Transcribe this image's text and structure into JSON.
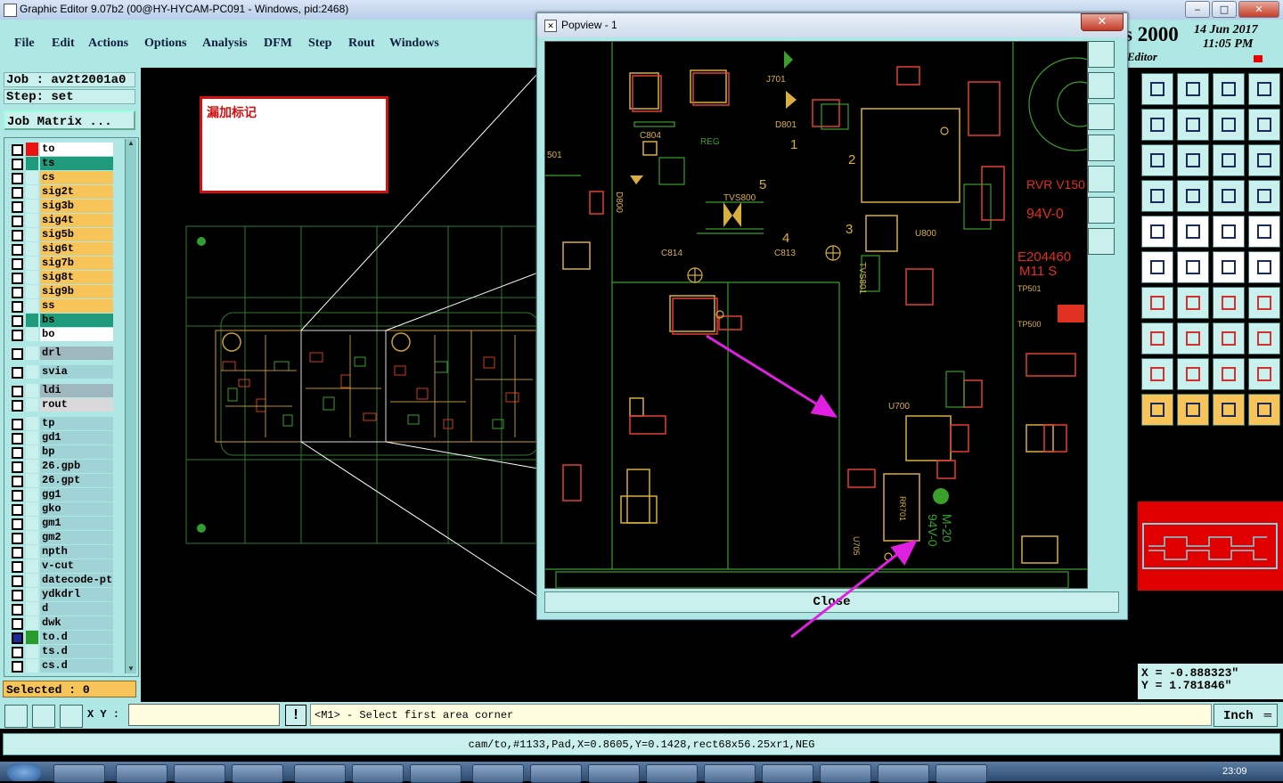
{
  "window": {
    "title": "Graphic Editor 9.07b2 (00@HY-HYCAM-PC091 - Windows, pid:2468)",
    "min": "‒",
    "max": "□",
    "close": "✕"
  },
  "menu": [
    "File",
    "Edit",
    "Actions",
    "Options",
    "Analysis",
    "DFM",
    "Step",
    "Rout",
    "Windows"
  ],
  "header": {
    "product": "s 2000",
    "date": "14 Jun 2017",
    "time": "11:05 PM",
    "editor": "Editor"
  },
  "left": {
    "job": "Job : av2t2001a0",
    "step": "Step: set",
    "job_matrix": "Job Matrix ...",
    "selected": "Selected : 0",
    "layers": [
      {
        "name": "to",
        "color": "#ffffff",
        "swatch": "#ee1111"
      },
      {
        "name": "ts",
        "color": "#1f9a7a",
        "swatch": "#1f9a7a"
      },
      {
        "name": "cs",
        "color": "#f7c45a",
        "swatch": "#c9f0ec"
      },
      {
        "name": "sig2t",
        "color": "#f7c45a",
        "swatch": "#c9f0ec"
      },
      {
        "name": "sig3b",
        "color": "#f7c45a",
        "swatch": "#c9f0ec"
      },
      {
        "name": "sig4t",
        "color": "#f7c45a",
        "swatch": "#c9f0ec"
      },
      {
        "name": "sig5b",
        "color": "#f7c45a",
        "swatch": "#c9f0ec"
      },
      {
        "name": "sig6t",
        "color": "#f7c45a",
        "swatch": "#c9f0ec"
      },
      {
        "name": "sig7b",
        "color": "#f7c45a",
        "swatch": "#c9f0ec"
      },
      {
        "name": "sig8t",
        "color": "#f7c45a",
        "swatch": "#c9f0ec"
      },
      {
        "name": "sig9b",
        "color": "#f7c45a",
        "swatch": "#c9f0ec"
      },
      {
        "name": "ss",
        "color": "#f7c45a",
        "swatch": "#c9f0ec"
      },
      {
        "name": "bs",
        "color": "#1f9a7a",
        "swatch": "#1f9a7a"
      },
      {
        "name": "bo",
        "color": "#ffffff",
        "swatch": "#c9f0ec"
      },
      {
        "name": "drl",
        "color": "#9fb7bf",
        "swatch": "#c9f0ec"
      },
      {
        "name": "svia",
        "color": "#9fd3d5",
        "swatch": "#c9f0ec"
      },
      {
        "name": "ldi",
        "color": "#9fb7bf",
        "swatch": "#c9f0ec"
      },
      {
        "name": "rout",
        "color": "#d9d9d9",
        "swatch": "#c9f0ec"
      },
      {
        "name": "tp",
        "color": "#9fd3d5",
        "swatch": "#c9f0ec"
      },
      {
        "name": "gd1",
        "color": "#9fd3d5",
        "swatch": "#c9f0ec"
      },
      {
        "name": "bp",
        "color": "#9fd3d5",
        "swatch": "#c9f0ec"
      },
      {
        "name": "26.gpb",
        "color": "#9fd3d5",
        "swatch": "#c9f0ec"
      },
      {
        "name": "26.gpt",
        "color": "#9fd3d5",
        "swatch": "#c9f0ec"
      },
      {
        "name": "gg1",
        "color": "#9fd3d5",
        "swatch": "#c9f0ec"
      },
      {
        "name": "gko",
        "color": "#9fd3d5",
        "swatch": "#c9f0ec"
      },
      {
        "name": "gm1",
        "color": "#9fd3d5",
        "swatch": "#c9f0ec"
      },
      {
        "name": "gm2",
        "color": "#9fd3d5",
        "swatch": "#c9f0ec"
      },
      {
        "name": "npth",
        "color": "#9fd3d5",
        "swatch": "#c9f0ec"
      },
      {
        "name": "v-cut",
        "color": "#9fd3d5",
        "swatch": "#c9f0ec"
      },
      {
        "name": "datecode-pt",
        "color": "#9fd3d5",
        "swatch": "#c9f0ec"
      },
      {
        "name": "ydkdrl",
        "color": "#9fd3d5",
        "swatch": "#c9f0ec"
      },
      {
        "name": "d",
        "color": "#9fd3d5",
        "swatch": "#c9f0ec"
      },
      {
        "name": "dwk",
        "color": "#9fd3d5",
        "swatch": "#c9f0ec"
      },
      {
        "name": "to.d",
        "color": "#9fd3d5",
        "swatch": "#2a9a2a",
        "active": true
      },
      {
        "name": "ts.d",
        "color": "#9fd3d5",
        "swatch": "#c9f0ec"
      },
      {
        "name": "cs.d",
        "color": "#9fd3d5",
        "swatch": "#c9f0ec"
      }
    ]
  },
  "note": {
    "text": "漏加标记"
  },
  "popup": {
    "title": "Popview - 1",
    "close_label": "Close",
    "close_x": "✕",
    "pcb_labels": [
      "J701",
      "C804",
      "REG",
      "D801",
      "501",
      "D800",
      "5",
      "1",
      "2",
      "TVS800",
      "4",
      "3",
      "C814",
      "C813",
      "U800",
      "TVS801",
      "U700",
      "RVR V150",
      "94V-0",
      "E204460",
      "M11 S",
      "TP501",
      "TP500",
      "94V-0",
      "M-20",
      "RR701",
      "U705"
    ]
  },
  "right": {
    "coord_x": "X = -0.888323\"",
    "coord_y": "Y = 1.781846\""
  },
  "bottom": {
    "xy_label": "X Y :",
    "xy_value": "",
    "bang": "!",
    "prompt": "<M1> - Select first area corner",
    "units": "Inch",
    "status": "cam/to,#1133,Pad,X=0.8605,Y=0.1428,rect68x56.25xr1,NEG"
  },
  "taskbar": {
    "clock": "23:09"
  },
  "colors": {
    "panel": "#aee7e3",
    "pcb_green": "#3aa02a",
    "pcb_yellow": "#e0b040",
    "pcb_red": "#e03020",
    "arrow": "#e020e0",
    "note_border": "#d01010"
  }
}
